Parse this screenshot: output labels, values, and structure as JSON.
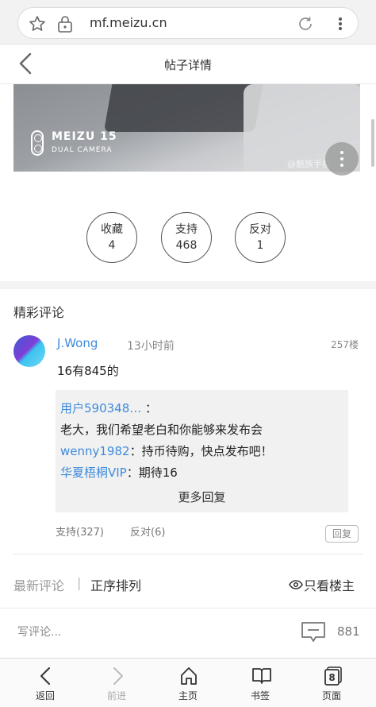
{
  "browser": {
    "url": "mf.meizu.cn",
    "icons": [
      "star-icon",
      "lock-icon",
      "reload-icon",
      "more-vertical-icon"
    ]
  },
  "header": {
    "title": "帖子详情"
  },
  "image": {
    "brand_model": "MEIZU 15",
    "brand_sub": "DUAL CAMERA",
    "watermark": "@魅族手机"
  },
  "actions": [
    {
      "label": "收藏",
      "count": "4"
    },
    {
      "label": "支持",
      "count": "468"
    },
    {
      "label": "反对",
      "count": "1"
    }
  ],
  "comments_section": {
    "title": "精彩评论"
  },
  "comment": {
    "author": "J.Wong",
    "time": "13小时前",
    "floor": "257楼",
    "text": "16有845的",
    "replies": [
      {
        "user": "用户590348…",
        "sep": "：",
        "text": ""
      },
      {
        "user": "",
        "sep": "",
        "text": "老大，我们希望老白和你能够来发布会"
      },
      {
        "user": "wenny1982",
        "sep": "：",
        "text": "持币待购，快点发布吧！"
      },
      {
        "user": "华夏梧桐VIP",
        "sep": "：",
        "text": "期待16"
      }
    ],
    "more_replies": "更多回复",
    "support": "支持(327)",
    "oppose": "反对(6)",
    "reply_button": "回复"
  },
  "sort": {
    "latest": "最新评论",
    "separator": "|",
    "order": "正序排列",
    "op_only": "只看楼主"
  },
  "input": {
    "placeholder": "写评论...",
    "comment_count": "881"
  },
  "bottom_nav": {
    "back": "返回",
    "forward": "前进",
    "home": "主页",
    "bookmarks": "书签",
    "pages": "页面",
    "pages_count": "8"
  },
  "colors": {
    "link_blue": "#3d8bdc",
    "reply_bg": "#f1f1f1",
    "divider": "#f3f3f3"
  }
}
